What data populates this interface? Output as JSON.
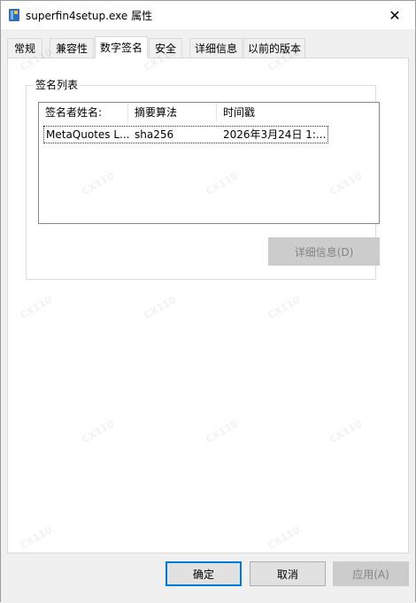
{
  "window": {
    "title": "superfin4setup.exe 属性",
    "close_glyph": "✕"
  },
  "tabs": [
    {
      "label": "常规"
    },
    {
      "label": "兼容性"
    },
    {
      "label": "数字签名",
      "active": true
    },
    {
      "label": "安全"
    },
    {
      "label": "详细信息"
    },
    {
      "label": "以前的版本"
    }
  ],
  "signature_group": {
    "label": "签名列表",
    "columns": [
      "签名者姓名:",
      "摘要算法",
      "时间戳"
    ],
    "rows": [
      {
        "signer": "MetaQuotes L...",
        "algorithm": "sha256",
        "timestamp": "2026年3月24日 1:..."
      }
    ],
    "details_button": "详细信息(D)"
  },
  "footer": {
    "ok_label": "确定",
    "cancel_label": "取消",
    "apply_label": "应用(A)"
  },
  "watermark": {
    "text": "CX110"
  },
  "colors": {
    "accent": "#0078d7",
    "disabled_button": "#cccccc",
    "panel": "#ffffff",
    "window_bg": "#f0f0f0"
  }
}
